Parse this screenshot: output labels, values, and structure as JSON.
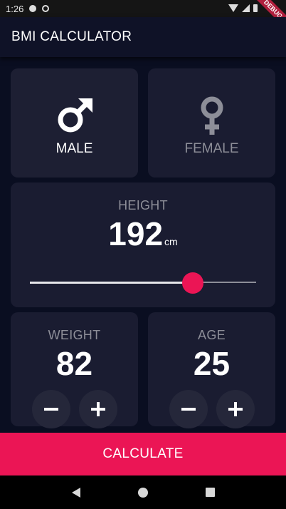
{
  "status_bar": {
    "time": "1:26",
    "debug_banner": "DEBUG"
  },
  "app_bar": {
    "title": "BMI CALCULATOR"
  },
  "gender": {
    "male_label": "MALE",
    "female_label": "FEMALE",
    "selected": "male",
    "male_icon": "male-symbol-icon",
    "female_icon": "female-symbol-icon"
  },
  "height": {
    "label": "HEIGHT",
    "value": "192",
    "unit": "cm",
    "slider_fraction": 0.72
  },
  "weight": {
    "label": "WEIGHT",
    "value": "82"
  },
  "age": {
    "label": "AGE",
    "value": "25"
  },
  "calculate_label": "CALCULATE",
  "colors": {
    "background": "#0a0e21",
    "card": "#1a1c31",
    "accent": "#eb1555",
    "inactive_text": "#8d8e98",
    "round_button": "#25273a"
  },
  "nav": {
    "back_icon": "back-triangle-icon",
    "home_icon": "home-circle-icon",
    "recent_icon": "recent-square-icon"
  }
}
